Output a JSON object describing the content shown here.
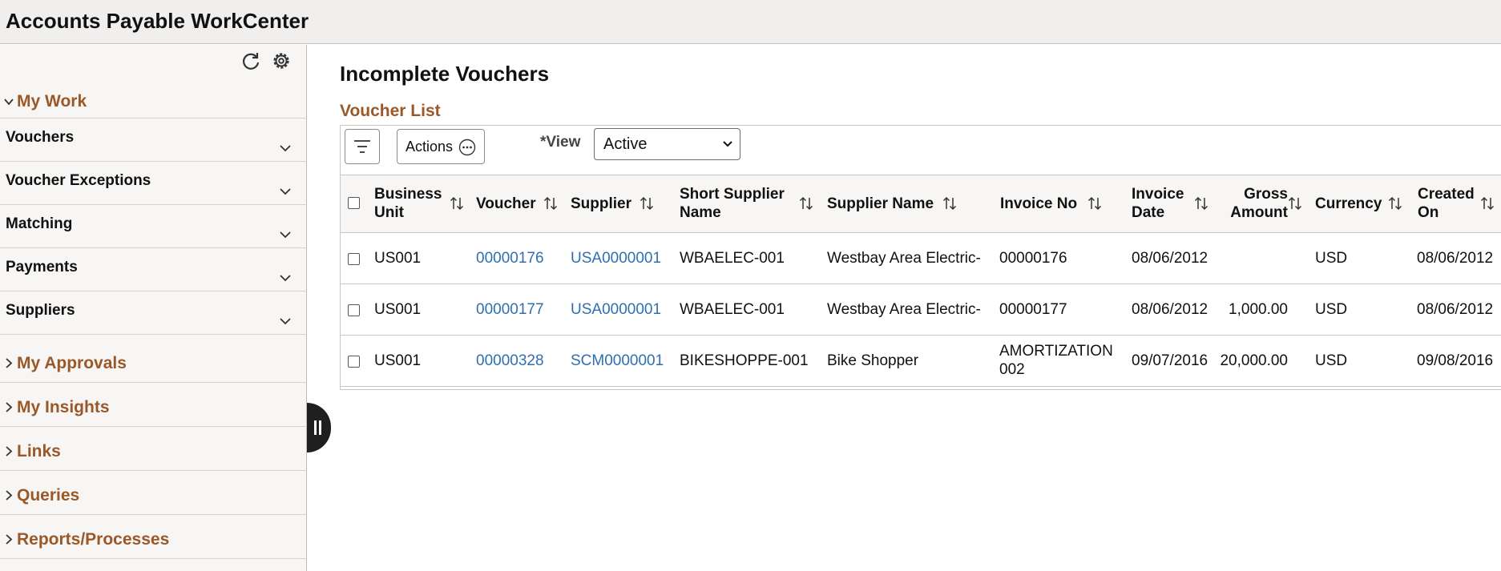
{
  "app": {
    "title": "Accounts Payable WorkCenter"
  },
  "sidebar": {
    "refresh_icon": "refresh-icon",
    "settings_icon": "gear-icon",
    "my_work": {
      "label": "My Work",
      "items": [
        {
          "label": "Vouchers"
        },
        {
          "label": "Voucher Exceptions"
        },
        {
          "label": "Matching"
        },
        {
          "label": "Payments"
        },
        {
          "label": "Suppliers"
        }
      ]
    },
    "sections": [
      {
        "label": "My Approvals"
      },
      {
        "label": "My Insights"
      },
      {
        "label": "Links"
      },
      {
        "label": "Queries"
      },
      {
        "label": "Reports/Processes"
      }
    ]
  },
  "main": {
    "page_title": "Incomplete Vouchers",
    "list_title": "Voucher List",
    "toolbar": {
      "actions_label": "Actions",
      "view_label": "*View",
      "view_value": "Active"
    },
    "columns": {
      "business_unit": [
        "Business",
        "Unit"
      ],
      "voucher": "Voucher",
      "supplier": "Supplier",
      "short_supplier_name": [
        "Short Supplier",
        "Name"
      ],
      "supplier_name": "Supplier Name",
      "invoice_no": "Invoice No",
      "invoice_date": [
        "Invoice",
        "Date"
      ],
      "gross_amount": [
        "Gross",
        "Amount"
      ],
      "currency": "Currency",
      "created_on": [
        "Created",
        "On"
      ]
    },
    "rows": [
      {
        "business_unit": "US001",
        "voucher": "00000176",
        "supplier": "USA0000001",
        "short_supplier_name": "WBAELEC-001",
        "supplier_name": "Westbay Area Electric-",
        "invoice_no": [
          "00000176",
          ""
        ],
        "invoice_date": "08/06/2012",
        "gross_amount": "",
        "currency": "USD",
        "created_on": "08/06/2012"
      },
      {
        "business_unit": "US001",
        "voucher": "00000177",
        "supplier": "USA0000001",
        "short_supplier_name": "WBAELEC-001",
        "supplier_name": "Westbay Area Electric-",
        "invoice_no": [
          "00000177",
          ""
        ],
        "invoice_date": "08/06/2012",
        "gross_amount": "1,000.00",
        "currency": "USD",
        "created_on": "08/06/2012"
      },
      {
        "business_unit": "US001",
        "voucher": "00000328",
        "supplier": "SCM0000001",
        "short_supplier_name": "BIKESHOPPE-001",
        "supplier_name": "Bike Shopper",
        "invoice_no": [
          "AMORTIZATION",
          "002"
        ],
        "invoice_date": "09/07/2016",
        "gross_amount": "20,000.00",
        "currency": "USD",
        "created_on": "09/08/2016"
      }
    ]
  },
  "colors": {
    "accent_brown": "#9a5829",
    "link_blue": "#2f6fb1",
    "header_bg": "#f0efee"
  }
}
